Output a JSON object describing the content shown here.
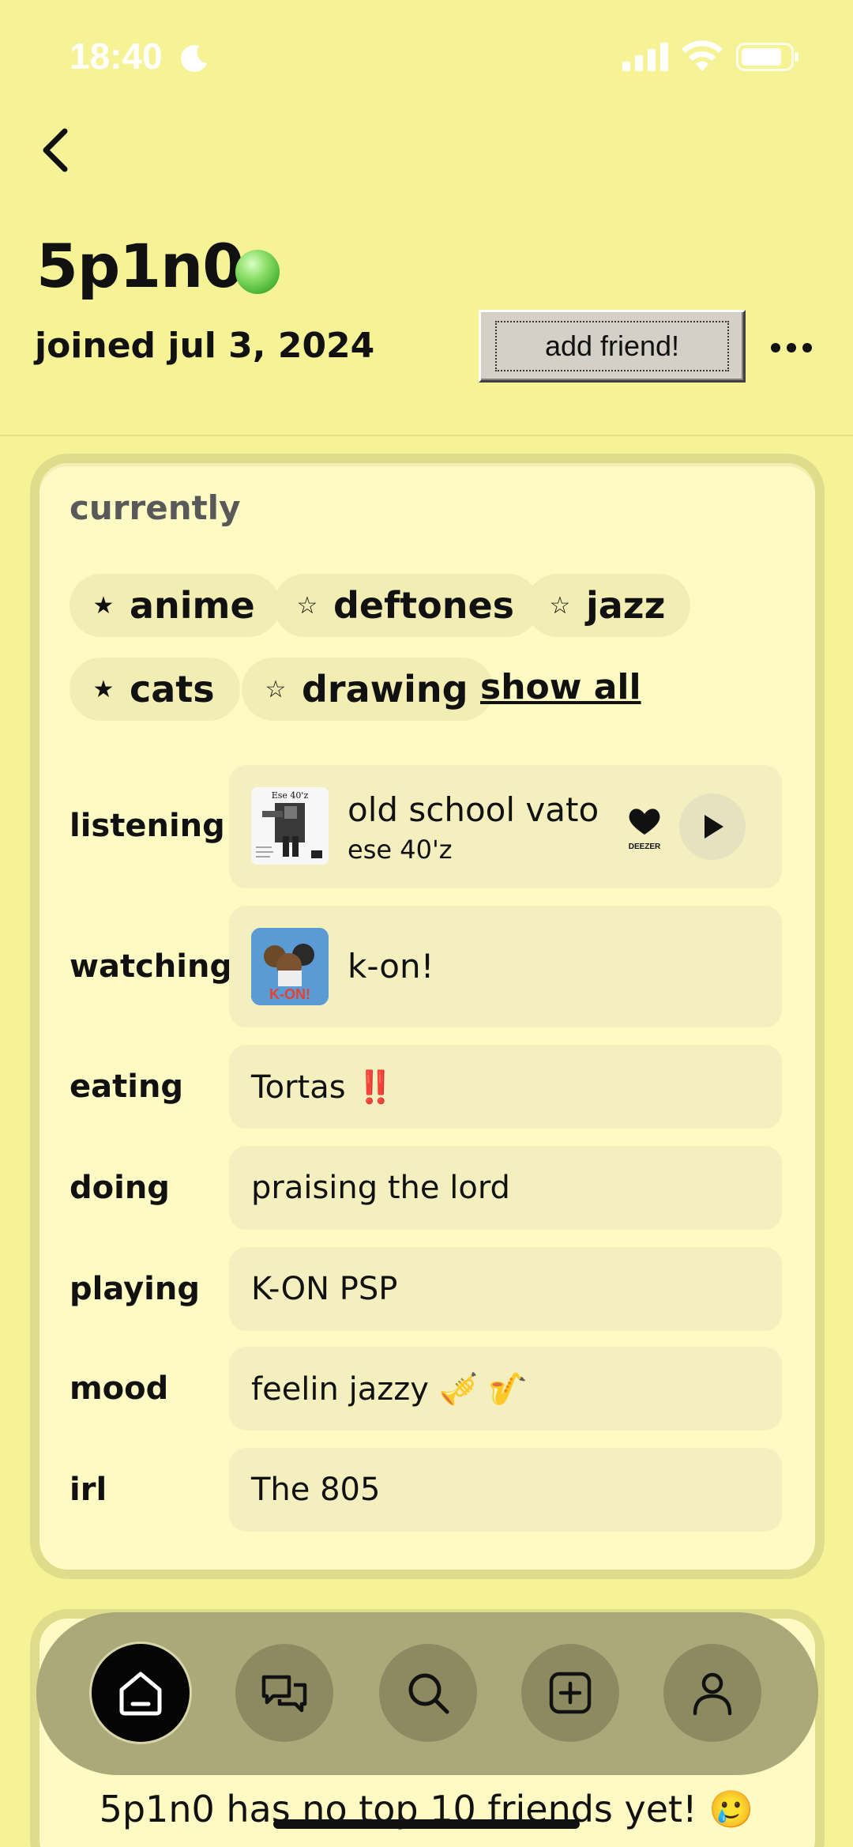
{
  "status_bar": {
    "time": "18:40"
  },
  "profile": {
    "username": "5p1n0",
    "joined": "joined jul 3, 2024",
    "add_friend_label": "add friend!"
  },
  "currently": {
    "title": "currently",
    "chips": [
      {
        "star": "★",
        "label": "anime"
      },
      {
        "star": "☆",
        "label": "deftones"
      },
      {
        "star": "☆",
        "label": "jazz"
      },
      {
        "star": "★",
        "label": "cats"
      },
      {
        "star": "☆",
        "label": "drawing"
      }
    ],
    "show_all": "show all"
  },
  "rows": {
    "listening": {
      "label": "listening",
      "title": "old school vato",
      "artist": "ese 40'z",
      "album_text": "Ese 40'z",
      "service": "DEEZER"
    },
    "watching": {
      "label": "watching",
      "value": "k-on!",
      "art_text": "K-ON!"
    },
    "eating": {
      "label": "eating",
      "value": "Tortas ‼️"
    },
    "doing": {
      "label": "doing",
      "value": "praising the lord"
    },
    "playing": {
      "label": "playing",
      "value": "K-ON PSP"
    },
    "mood": {
      "label": "mood",
      "value": "feelin jazzy 🎺 🎷"
    },
    "irl": {
      "label": "irl",
      "value": "The 805"
    }
  },
  "friends": {
    "empty_message": "5p1n0 has no top 10 friends yet! 🥲"
  },
  "tabs": [
    "home-icon",
    "messages-icon",
    "search-icon",
    "create-icon",
    "profile-icon"
  ],
  "colors": {
    "background": "#f5f396",
    "card": "#fdfac4",
    "online": "#5fcb45"
  }
}
